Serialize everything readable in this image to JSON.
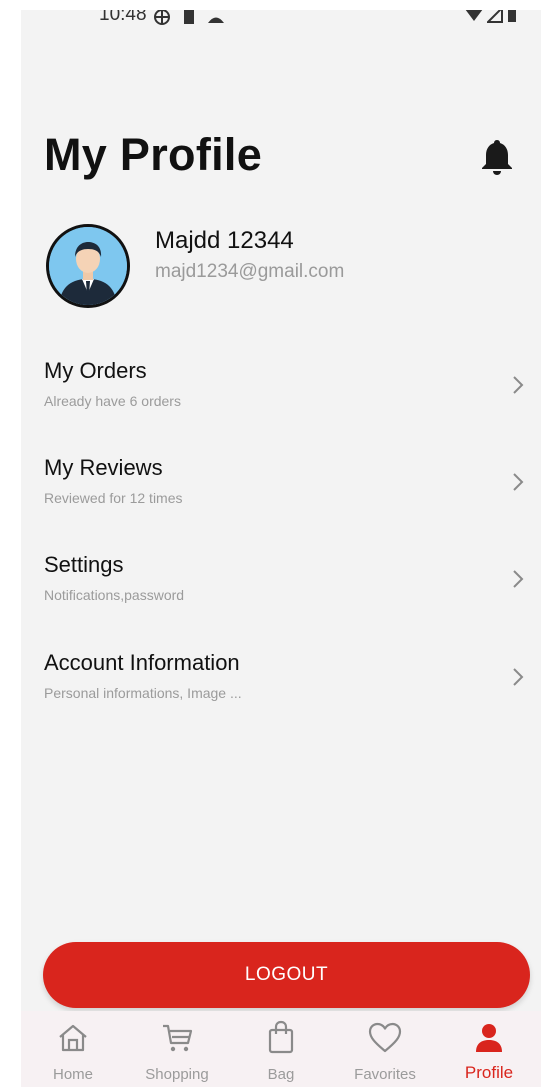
{
  "status_bar": {
    "time": "10:48"
  },
  "header": {
    "title": "My Profile"
  },
  "user": {
    "name": "Majdd 12344",
    "email": "majd1234@gmail.com"
  },
  "menu": [
    {
      "title": "My Orders",
      "subtitle": "Already have 6 orders"
    },
    {
      "title": "My Reviews",
      "subtitle": "Reviewed for 12 times"
    },
    {
      "title": "Settings",
      "subtitle": "Notifications,password"
    },
    {
      "title": "Account Information",
      "subtitle": "Personal informations, Image ..."
    }
  ],
  "logout_label": "LOGOUT",
  "bottom_nav": [
    {
      "label": "Home",
      "icon": "home-icon"
    },
    {
      "label": "Shopping",
      "icon": "cart-icon"
    },
    {
      "label": "Bag",
      "icon": "bag-icon"
    },
    {
      "label": "Favorites",
      "icon": "heart-icon"
    },
    {
      "label": "Profile",
      "icon": "person-icon",
      "active": true
    }
  ],
  "colors": {
    "accent": "#d9251d",
    "background": "#f3f3f3",
    "nav_background": "#f7f1f3",
    "muted_text": "#9b9b9b"
  }
}
